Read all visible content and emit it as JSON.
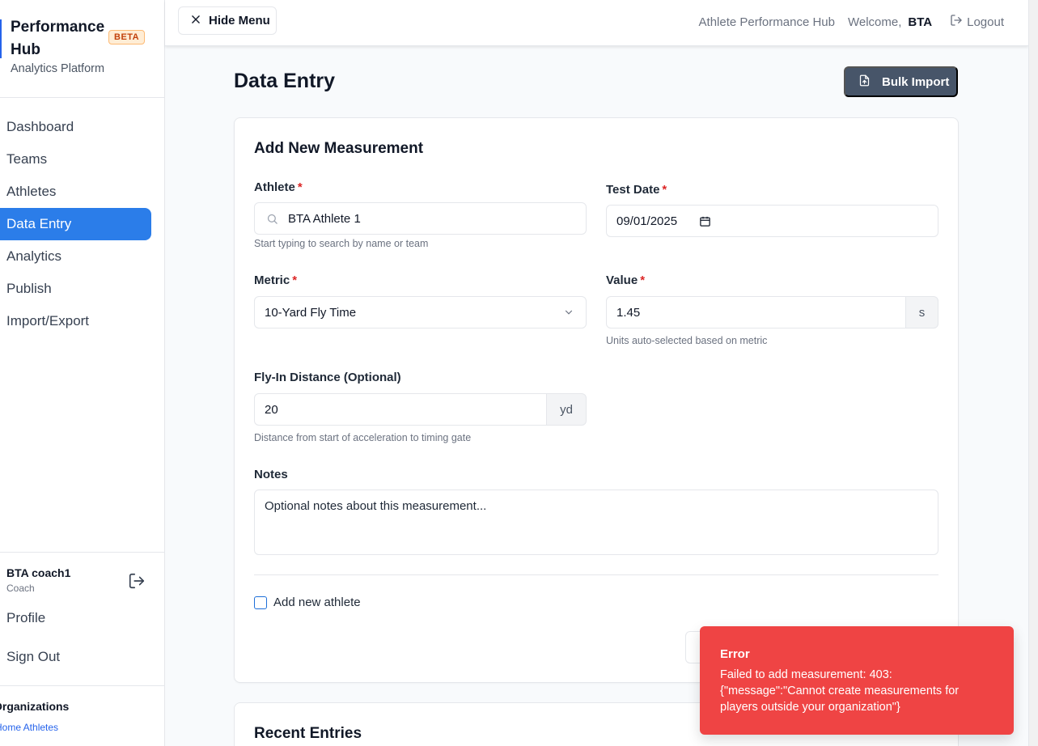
{
  "sidebar": {
    "brand_title": "Performance Hub",
    "brand_badge": "BETA",
    "brand_subtitle": "Analytics Platform",
    "items": [
      {
        "label": "Dashboard",
        "active": false
      },
      {
        "label": "Teams",
        "active": false
      },
      {
        "label": "Athletes",
        "active": false
      },
      {
        "label": "Data Entry",
        "active": true
      },
      {
        "label": "Analytics",
        "active": false
      },
      {
        "label": "Publish",
        "active": false
      },
      {
        "label": "Import/Export",
        "active": false
      }
    ],
    "user": {
      "name": "BTA coach1",
      "role": "Coach"
    },
    "profile_label": "Profile",
    "signout_label": "Sign Out",
    "orgs_title": "Organizations",
    "orgs_link": "Home Athletes"
  },
  "topbar": {
    "hide_menu_label": "Hide Menu",
    "app_name": "Athlete Performance Hub",
    "welcome_label": "Welcome,",
    "username": "BTA",
    "logout_label": "Logout"
  },
  "page": {
    "title": "Data Entry",
    "bulk_import_label": "Bulk Import"
  },
  "form": {
    "card_title": "Add New Measurement",
    "athlete": {
      "label": "Athlete",
      "required": "*",
      "value": "BTA Athlete 1",
      "help": "Start typing to search by name or team"
    },
    "test_date": {
      "label": "Test Date",
      "required": "*",
      "value": "09/01/2025"
    },
    "metric": {
      "label": "Metric",
      "required": "*",
      "value": "10-Yard Fly Time"
    },
    "value": {
      "label": "Value",
      "required": "*",
      "value": "1.45",
      "unit": "s",
      "help": "Units auto-selected based on metric"
    },
    "fly_in": {
      "label": "Fly-In Distance (Optional)",
      "value": "20",
      "unit": "yd",
      "help": "Distance from start of acceleration to timing gate"
    },
    "notes": {
      "label": "Notes",
      "placeholder": "Optional notes about this measurement..."
    },
    "add_athlete_label": "Add new athlete",
    "add_athlete_checked": false
  },
  "recent": {
    "title": "Recent Entries"
  },
  "toast": {
    "title": "Error",
    "message": "Failed to add measurement: 403: {\"message\":\"Cannot create measurements for players outside your organization\"}"
  },
  "colors": {
    "accent": "#2b7de9",
    "toast_bg": "#ef4444",
    "button_dark": "#475569",
    "required": "#dc2626"
  }
}
